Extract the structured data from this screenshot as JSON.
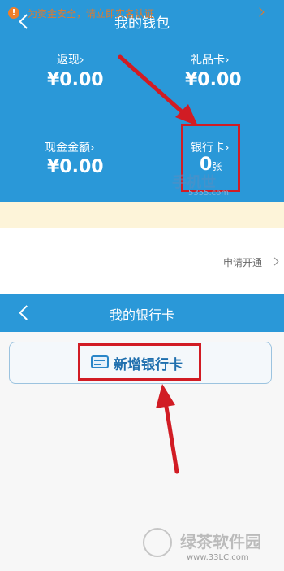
{
  "wallet": {
    "title": "我的钱包",
    "cashback_label": "返现",
    "cashback_value": "¥0.00",
    "giftcard_label": "礼品卡",
    "giftcard_value": "¥0.00",
    "cash_label": "现金金额",
    "cash_value": "¥0.00",
    "bankcard_label": "银行卡",
    "bankcard_count": "0",
    "bankcard_unit": "张",
    "notice_text": "为资金安全，请立即实名认证",
    "apply_link": "申请开通"
  },
  "bank": {
    "title": "我的银行卡",
    "add_card_label": "新增银行卡"
  },
  "watermarks": {
    "site_title": "手机世",
    "domain_top": "5355.com",
    "brand": "绿茶软件园",
    "domain_bottom": "www.33LC.com"
  },
  "colors": {
    "header_blue": "#2a98d8",
    "highlight_red": "#d11c24",
    "notice_orange": "#e07a2c"
  },
  "icons": {
    "back": "chevron-left-icon",
    "chevron": "chevron-right-icon",
    "alert": "exclamation-icon",
    "card": "credit-card-icon",
    "arrow": "red-pointer-arrow"
  }
}
